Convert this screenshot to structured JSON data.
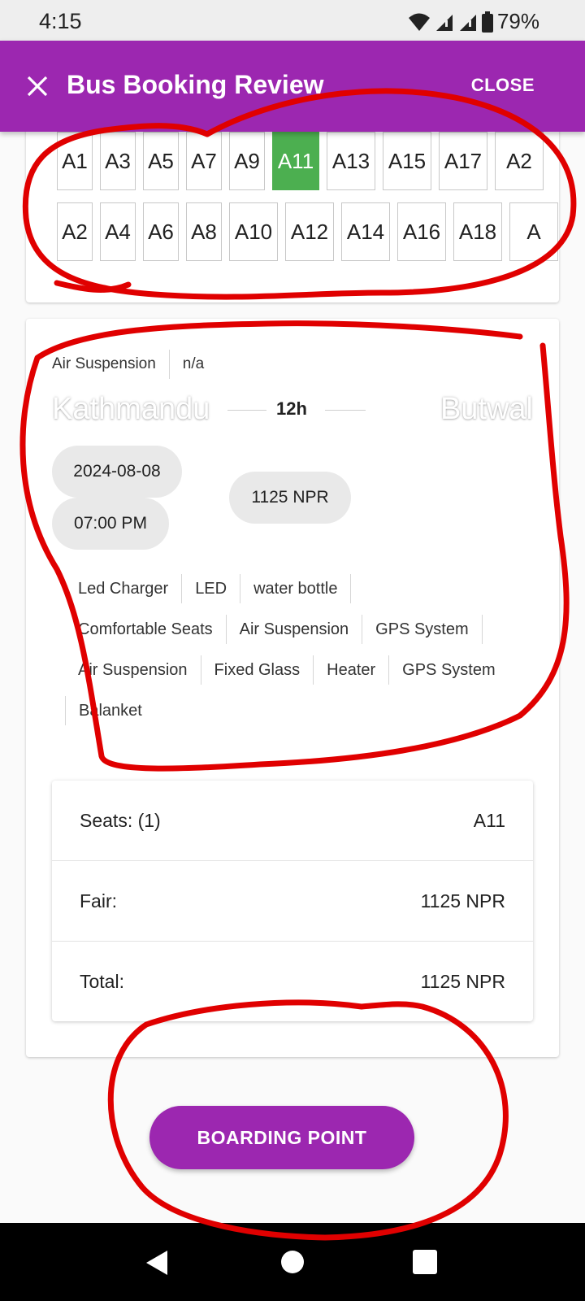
{
  "status_bar": {
    "time": "4:15",
    "battery": "79%",
    "icons": [
      "wifi-icon",
      "signal-icon",
      "signal-icon",
      "battery-icon"
    ]
  },
  "app_bar": {
    "title": "Bus Booking Review",
    "close_label": "CLOSE",
    "close_icon": "close-icon",
    "color": "#9c27b0"
  },
  "seats": {
    "row1": [
      "A1",
      "A3",
      "A5",
      "A7",
      "A9",
      "A11",
      "A13",
      "A15",
      "A17",
      "A2"
    ],
    "row2": [
      "A2",
      "A4",
      "A6",
      "A8",
      "A10",
      "A12",
      "A14",
      "A16",
      "A18",
      "A"
    ],
    "selected": "A11",
    "selected_color": "#4caf50"
  },
  "trip": {
    "bus_features": [
      "Air Suspension",
      "n/a"
    ],
    "from": "Kathmandu",
    "to": "Butwal",
    "duration": "12h",
    "date": "2024-08-08",
    "time": "07:00 PM",
    "price": "1125 NPR"
  },
  "amenities": {
    "line1": [
      "Led Charger",
      "LED",
      "water bottle"
    ],
    "line2": [
      "Comfortable Seats",
      "Air Suspension",
      "GPS System"
    ],
    "line3": [
      "Air Suspension",
      "Fixed Glass",
      "Heater",
      "GPS System"
    ],
    "line4": [
      "Balanket"
    ]
  },
  "summary": {
    "seats_label": "Seats: (1)",
    "seats_value": "A11",
    "fare_label": "Fair:",
    "fare_value": "1125 NPR",
    "total_label": "Total:",
    "total_value": "1125 NPR"
  },
  "actions": {
    "boarding_point_label": "BOARDING POINT"
  },
  "annotation_color": "#e00000"
}
